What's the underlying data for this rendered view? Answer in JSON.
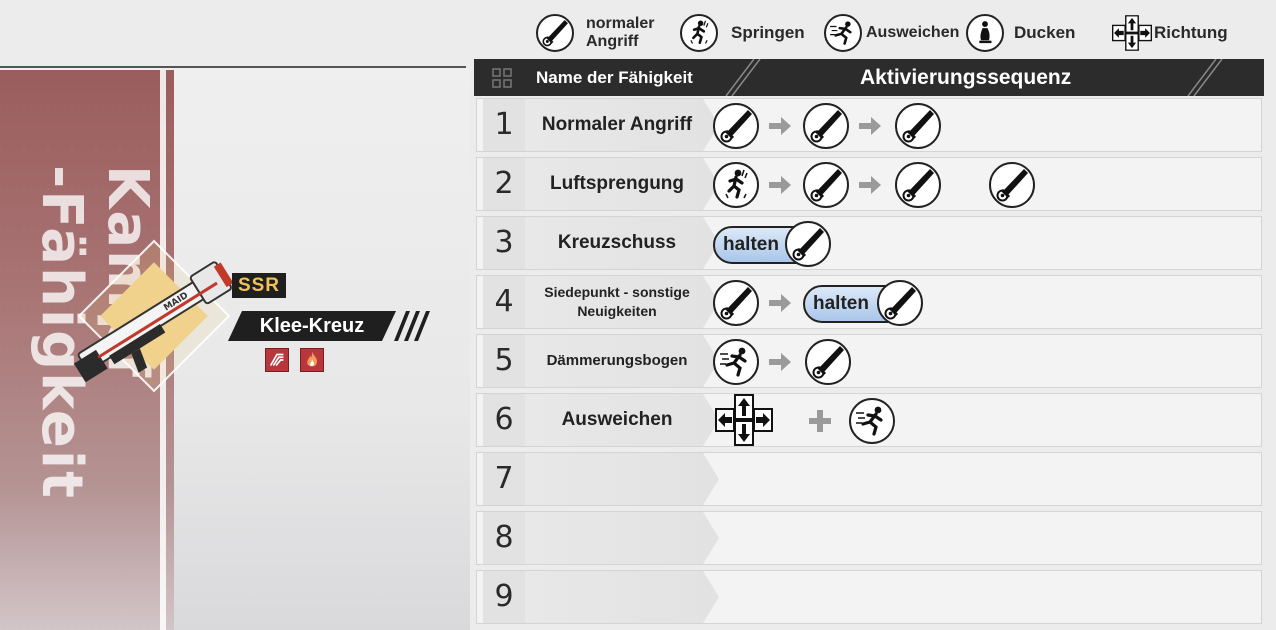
{
  "legend": [
    {
      "icon": "attack-icon",
      "label_line1": "normaler",
      "label_line2": "Angriff"
    },
    {
      "icon": "jump-icon",
      "label": "Springen"
    },
    {
      "icon": "dodge-icon",
      "label": "Ausweichen"
    },
    {
      "icon": "crouch-icon",
      "label": "Ducken"
    },
    {
      "icon": "direction-icon",
      "label": "Richtung"
    }
  ],
  "weapon": {
    "banner_title": "Kampf\n-Fähigkeit",
    "rarity": "SSR",
    "name": "Klee-Kreuz",
    "gun_marking": "MAID",
    "attributes": [
      "rush-attribute-icon",
      "fire-attribute-icon"
    ]
  },
  "table": {
    "header_name": "Name der Fähigkeit",
    "header_sequence": "Aktivierungssequenz",
    "hold_label": "halten",
    "rows": [
      {
        "num": "1",
        "name": "Normaler Angriff"
      },
      {
        "num": "2",
        "name": "Luftsprengung"
      },
      {
        "num": "3",
        "name": "Kreuzschuss"
      },
      {
        "num": "4",
        "name": "Siedepunkt - sonstige Neuigkeiten"
      },
      {
        "num": "5",
        "name": "Dämmerungsbogen"
      },
      {
        "num": "6",
        "name": "Ausweichen"
      },
      {
        "num": "7",
        "name": ""
      },
      {
        "num": "8",
        "name": ""
      },
      {
        "num": "9",
        "name": ""
      }
    ]
  },
  "colors": {
    "header_bg": "#2c2c2c",
    "hold_fill": "#aac6ea",
    "banner": "#a97474",
    "rarity_text": "#f0c35a"
  }
}
